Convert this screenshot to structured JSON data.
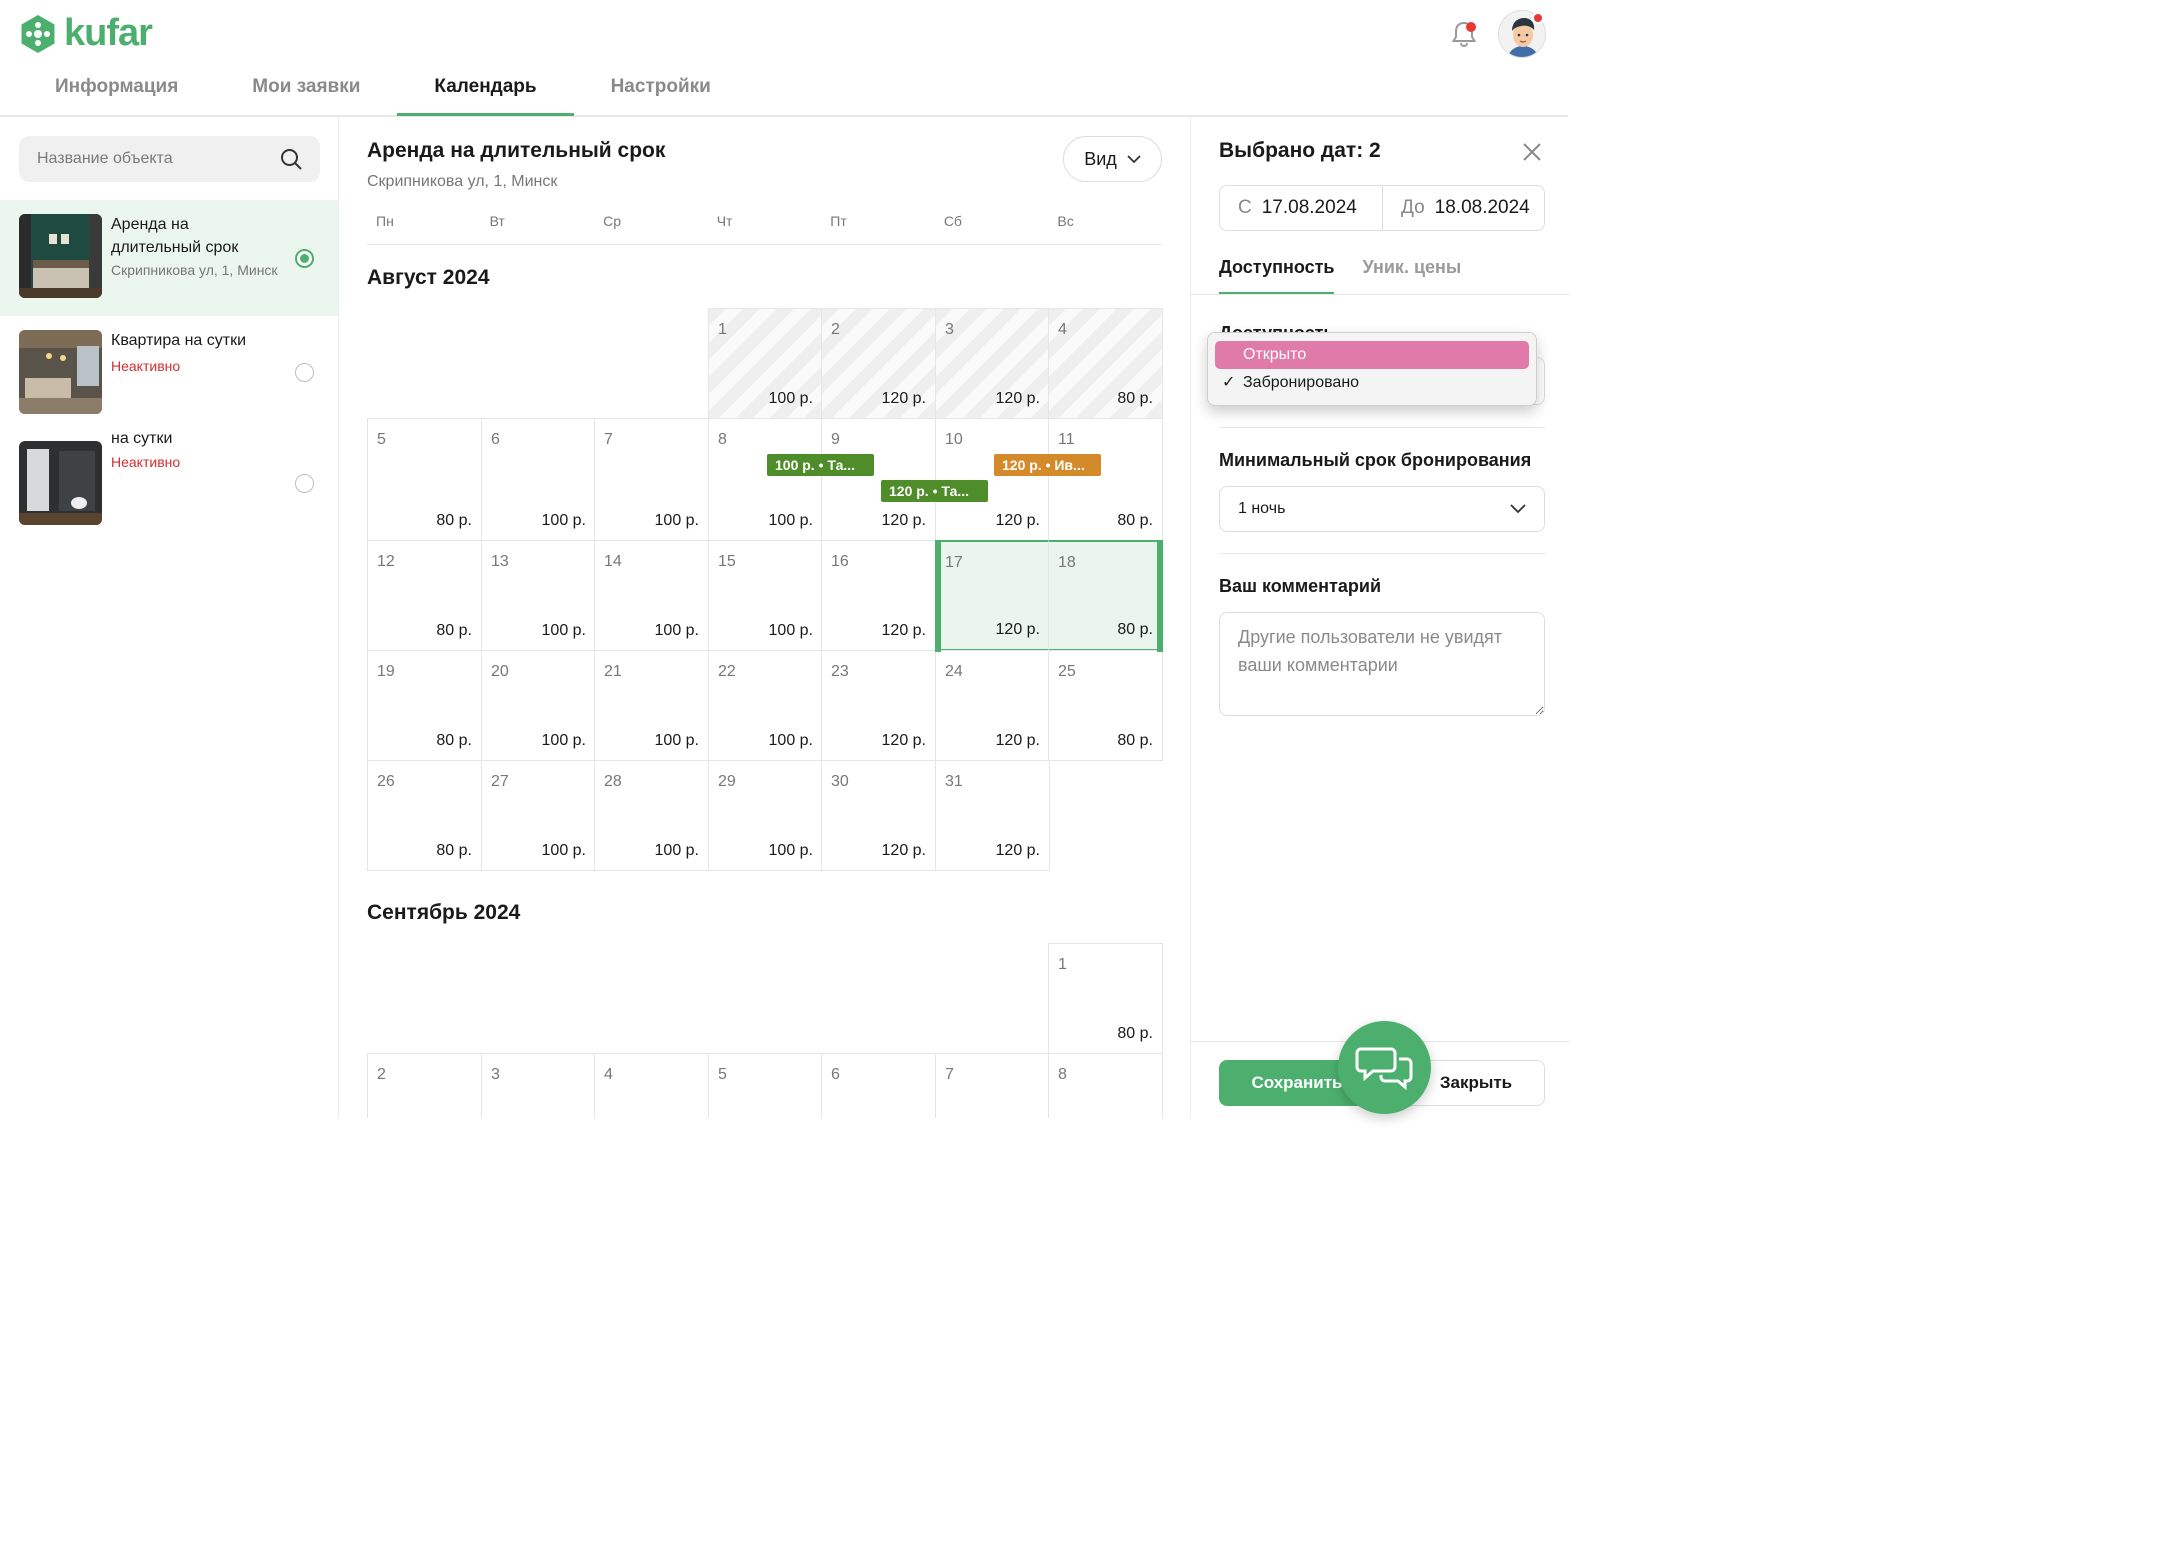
{
  "app": {
    "logo_text": "kufar",
    "brand_color": "#4caf6e",
    "alert_color": "#e53935"
  },
  "nav": {
    "tabs": [
      {
        "label": "Информация"
      },
      {
        "label": "Мои заявки"
      },
      {
        "label": "Календарь",
        "active": true
      },
      {
        "label": "Настройки"
      }
    ],
    "icons": [
      "bell-icon",
      "user-avatar"
    ]
  },
  "sidebar": {
    "search": {
      "placeholder": "Название объекта",
      "icon": "search-icon"
    },
    "listings": [
      {
        "title": "Аренда на длительный срок",
        "subtitle": "Скрипникова ул, 1, Минск",
        "selected": true
      },
      {
        "title": "Квартира на сутки",
        "status": "Неактивно",
        "selected": false
      },
      {
        "title": "на сутки",
        "status": "Неактивно",
        "selected": false
      }
    ]
  },
  "calendar": {
    "object_title": "Аренда на длительный срок",
    "object_address": "Скрипникова ул, 1, Минск",
    "view_button": "Вид",
    "weekdays": [
      "Пн",
      "Вт",
      "Ср",
      "Чт",
      "Пт",
      "Сб",
      "Вс"
    ],
    "months": [
      {
        "title": "Август 2024",
        "weeks": [
          [
            null,
            null,
            null,
            {
              "d": "1",
              "p": "100 р.",
              "past": true
            },
            {
              "d": "2",
              "p": "120 р.",
              "past": true
            },
            {
              "d": "3",
              "p": "120 р.",
              "past": true
            },
            {
              "d": "4",
              "p": "80 р.",
              "past": true
            }
          ],
          [
            {
              "d": "5",
              "p": "80 р."
            },
            {
              "d": "6",
              "p": "100 р."
            },
            {
              "d": "7",
              "p": "100 р."
            },
            {
              "d": "8",
              "p": "100 р."
            },
            {
              "d": "9",
              "p": "120 р."
            },
            {
              "d": "10",
              "p": "120 р."
            },
            {
              "d": "11",
              "p": "80 р."
            }
          ],
          [
            {
              "d": "12",
              "p": "80 р."
            },
            {
              "d": "13",
              "p": "100 р."
            },
            {
              "d": "14",
              "p": "100 р."
            },
            {
              "d": "15",
              "p": "100 р."
            },
            {
              "d": "16",
              "p": "120 р."
            },
            {
              "d": "17",
              "p": "120 р.",
              "sel": true
            },
            {
              "d": "18",
              "p": "80 р.",
              "sel": true
            }
          ],
          [
            {
              "d": "19",
              "p": "80 р."
            },
            {
              "d": "20",
              "p": "100 р."
            },
            {
              "d": "21",
              "p": "100 р."
            },
            {
              "d": "22",
              "p": "100 р."
            },
            {
              "d": "23",
              "p": "120 р."
            },
            {
              "d": "24",
              "p": "120 р."
            },
            {
              "d": "25",
              "p": "80 р."
            }
          ],
          [
            {
              "d": "26",
              "p": "80 р."
            },
            {
              "d": "27",
              "p": "100 р."
            },
            {
              "d": "28",
              "p": "100 р."
            },
            {
              "d": "29",
              "p": "100 р."
            },
            {
              "d": "30",
              "p": "120 р."
            },
            {
              "d": "31",
              "p": "120 р."
            },
            null
          ]
        ],
        "bookings": [
          {
            "label": "100 р. • Та...",
            "color": "#4f8c2a"
          },
          {
            "label": "120 р. • Та...",
            "color": "#4f8c2a"
          },
          {
            "label": "120 р. • Ив...",
            "color": "#d48a2a"
          }
        ]
      },
      {
        "title": "Сентябрь 2024",
        "weeks": [
          [
            null,
            null,
            null,
            null,
            null,
            null,
            {
              "d": "1",
              "p": "80 р."
            }
          ],
          [
            {
              "d": "2"
            },
            {
              "d": "3"
            },
            {
              "d": "4"
            },
            {
              "d": "5"
            },
            {
              "d": "6"
            },
            {
              "d": "7"
            },
            {
              "d": "8"
            }
          ]
        ]
      }
    ]
  },
  "panel": {
    "title": "Выбрано дат: 2",
    "from_label": "С",
    "from_value": "17.08.2024",
    "to_label": "До",
    "to_value": "18.08.2024",
    "tabs": [
      {
        "label": "Доступность",
        "active": true
      },
      {
        "label": "Уник. цены"
      }
    ],
    "availability_label": "Доступность",
    "availability_options": [
      {
        "label": "Открыто",
        "highlighted": true
      },
      {
        "label": "Забронировано",
        "checked": true
      }
    ],
    "highlight_color": "#e07aa8",
    "min_stay_label": "Минимальный срок бронирования",
    "min_stay_value": "1 ночь",
    "comment_label": "Ваш комментарий",
    "comment_placeholder": "Другие пользователи не увидят ваши комментарии",
    "save_button": "Сохранить",
    "close_button": "Закрыть",
    "chat_icon": "chat-icon"
  }
}
